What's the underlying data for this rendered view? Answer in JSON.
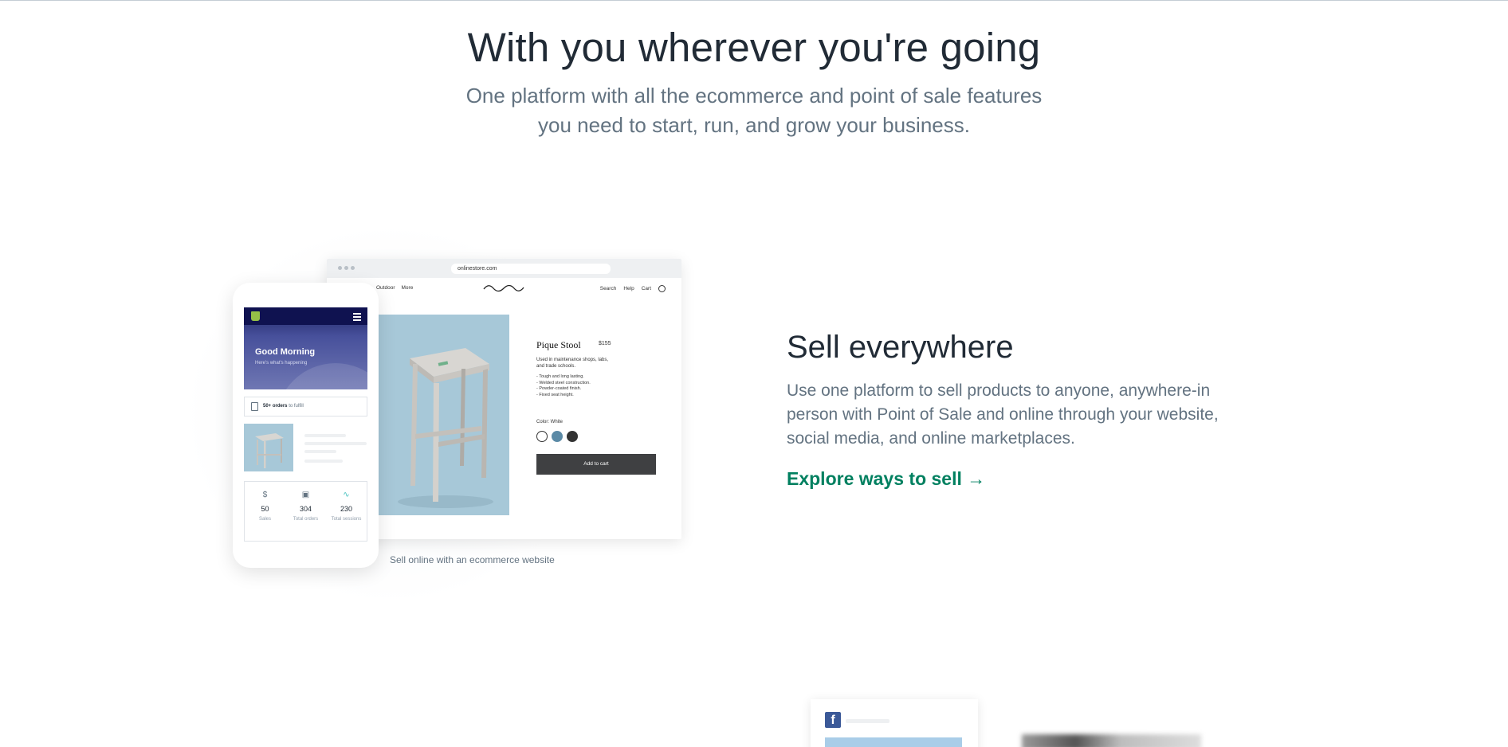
{
  "hero": {
    "title": "With you wherever you're going",
    "subtitle": "One platform with all the ecommerce and point of sale features you need to start, run, and grow your business."
  },
  "browser": {
    "url": "onlinestore.com",
    "nav_left": [
      "Outdoor",
      "More"
    ],
    "nav_right": [
      "Search",
      "Help",
      "Cart"
    ]
  },
  "product": {
    "title": "Pique Stool",
    "price": "$155",
    "description": "Used in maintenance shops, labs, and trade schools.",
    "features": [
      "- Tough and long lasting.",
      "- Welded steel construction.",
      "- Powder-coated finish.",
      "- Fixed seat height."
    ],
    "color_label": "Color: White",
    "swatches": [
      "#ffffff",
      "#5b8aa6",
      "#333333"
    ],
    "add_to_cart": "Add to cart"
  },
  "phone": {
    "greeting": "Good Morning",
    "greeting_sub": "Here's what's happening",
    "orders_bold": "50+ orders",
    "orders_rest": " to fulfill",
    "stats": [
      {
        "icon": "dollar-icon",
        "value": "50",
        "label": "Sales"
      },
      {
        "icon": "box-icon",
        "value": "304",
        "label": "Total orders"
      },
      {
        "icon": "pulse-icon",
        "value": "230",
        "label": "Total sessions"
      }
    ]
  },
  "caption": "Sell online with an ecommerce website",
  "feature": {
    "title": "Sell everywhere",
    "body": "Use one platform to sell products to anyone, anywhere-in person with Point of Sale and online through your website, social media, and online marketplaces.",
    "link": "Explore ways to sell →"
  },
  "colors": {
    "accent": "#008060",
    "heading": "#212b36",
    "muted": "#637381"
  }
}
